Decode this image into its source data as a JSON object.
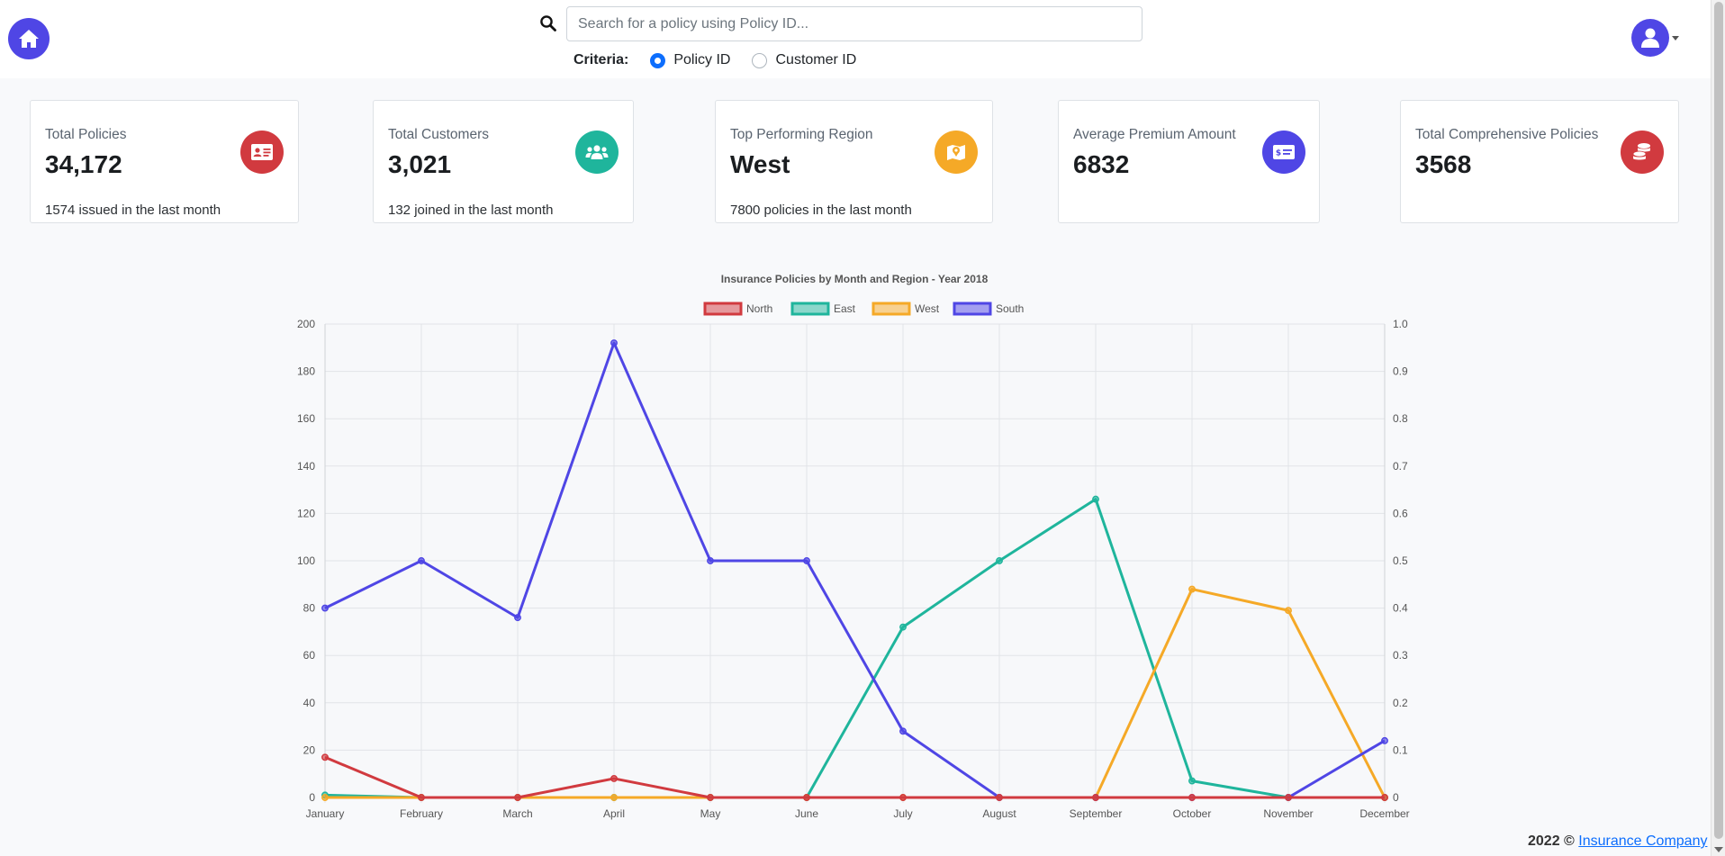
{
  "header": {
    "search_placeholder": "Search for a policy using Policy ID...",
    "criteria_label": "Criteria:",
    "options": [
      "Policy ID",
      "Customer ID"
    ],
    "selected": "Policy ID"
  },
  "cards": [
    {
      "title": "Total Policies",
      "value": "34,172",
      "sub": "1574 issued in the last month",
      "icon": "id-card-icon",
      "color": "#d13a3f"
    },
    {
      "title": "Total Customers",
      "value": "3,021",
      "sub": "132 joined in the last month",
      "icon": "users-icon",
      "color": "#1fb59c"
    },
    {
      "title": "Top Performing Region",
      "value": "West",
      "sub": "7800 policies in the last month",
      "icon": "map-icon",
      "color": "#f5a927"
    },
    {
      "title": "Average Premium Amount",
      "value": "6832",
      "sub": "",
      "icon": "money-bill-icon",
      "color": "#4f46e5"
    },
    {
      "title": "Total Comprehensive Policies",
      "value": "3568",
      "sub": "",
      "icon": "coins-icon",
      "color": "#d13a3f"
    }
  ],
  "chart_data": {
    "type": "line",
    "title": "Insurance Policies by Month and Region - Year 2018",
    "categories": [
      "January",
      "February",
      "March",
      "April",
      "May",
      "June",
      "July",
      "August",
      "September",
      "October",
      "November",
      "December"
    ],
    "ylim": [
      0,
      200
    ],
    "y_ticks": [
      0,
      20,
      40,
      60,
      80,
      100,
      120,
      140,
      160,
      180,
      200
    ],
    "y2lim": [
      0,
      1.0
    ],
    "y2_ticks": [
      "0",
      "0.1",
      "0.2",
      "0.3",
      "0.4",
      "0.5",
      "0.6",
      "0.7",
      "0.8",
      "0.9",
      "1.0"
    ],
    "grid": true,
    "legend": "top",
    "series": [
      {
        "name": "North",
        "color": "#d13a3f",
        "values": [
          17,
          0,
          0,
          8,
          0,
          0,
          0,
          0,
          0,
          0,
          0,
          0
        ]
      },
      {
        "name": "East",
        "color": "#1fb59c",
        "values": [
          1,
          0,
          0,
          0,
          0,
          0,
          72,
          100,
          126,
          7,
          0,
          0
        ]
      },
      {
        "name": "West",
        "color": "#f5a927",
        "values": [
          0,
          0,
          0,
          0,
          0,
          0,
          0,
          0,
          0,
          88,
          79,
          0
        ]
      },
      {
        "name": "South",
        "color": "#4f46e5",
        "values": [
          80,
          100,
          76,
          192,
          100,
          100,
          28,
          0,
          0,
          0,
          0,
          24
        ]
      }
    ]
  },
  "footer": {
    "year": "2022 ©",
    "link": "Insurance Company"
  }
}
